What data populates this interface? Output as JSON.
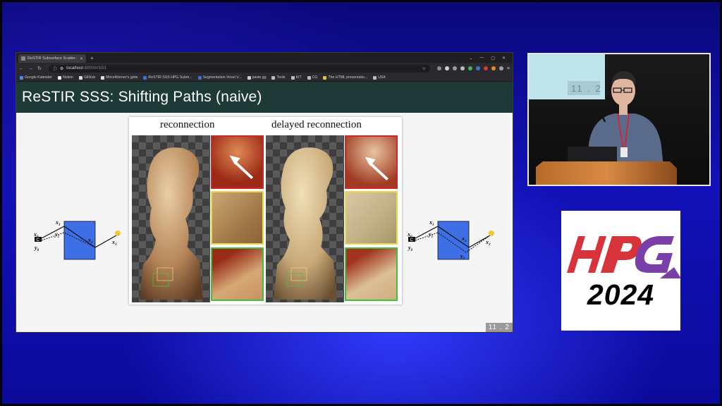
{
  "browser": {
    "tab_title": "ReSTIR Subsurface Scatter...",
    "new_tab": "+",
    "url_host": "localhost",
    "url_rest": ":8000/#/10/1",
    "bookmarks": [
      "Google Kalender",
      "Notion",
      "GitHub",
      "MirceWerner's gists",
      "ReSTIR SSS HPG Subm...",
      "Segmentation Voxel V...",
      "paste.gg",
      "Tools",
      "KIT",
      "CG",
      "The HTML presentatio...",
      "USA"
    ]
  },
  "slide": {
    "title": "ReSTIR SSS: Shifting Paths (naive)",
    "page_number": "11 . 2",
    "figure": {
      "left_label": "reconnection",
      "right_label": "delayed reconnection"
    },
    "diagram_labels": {
      "x0": "x",
      "x0_sub": "0",
      "y0": "y",
      "y0_sub": "0",
      "x1": "x",
      "x1_sub": "1",
      "y1": "y",
      "y1_sub": "1",
      "x2": "x",
      "x2_sub": "2",
      "y2": "y",
      "y2_sub": "2",
      "x3": "x",
      "x3_sub": "3",
      "camera_letter": "C"
    }
  },
  "camera_feed": {
    "screen_page_number": "11 . 2"
  },
  "logo": {
    "letters": "HPG",
    "year": "2024"
  },
  "colors": {
    "slide_header": "#1e3a36",
    "medium_box": "#3f6fe6",
    "crop_red": "#c72a2a",
    "crop_yellow": "#e9d94a",
    "crop_green": "#3fc13a",
    "logo_red": "#d8323a",
    "logo_purple": "#7a3fa8"
  }
}
